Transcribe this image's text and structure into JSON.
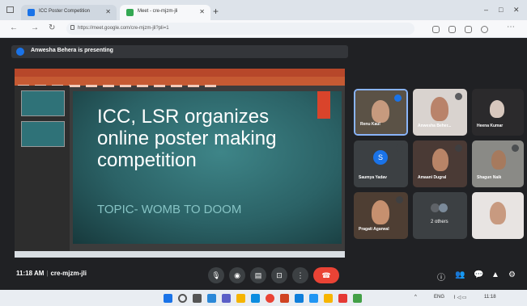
{
  "browser": {
    "tabs": [
      {
        "title": "ICC Poster Competition",
        "favicon_color": "#1a73e8"
      },
      {
        "title": "Meet - cre-mjzm-jli",
        "favicon_color": "#34a853"
      }
    ],
    "url": "https://meet.google.com/cre-mjzm-jli?pli=1",
    "window_buttons": [
      "–",
      "□",
      "✕"
    ]
  },
  "meet": {
    "presenting_text": "Anwesha Behera is presenting",
    "time": "11:18 AM",
    "meeting_code": "cre-mjzm-jli",
    "controls": [
      {
        "name": "mic",
        "glyph": "🎙"
      },
      {
        "name": "camera",
        "glyph": "◉"
      },
      {
        "name": "captions",
        "glyph": "▤"
      },
      {
        "name": "present",
        "glyph": "⊡"
      },
      {
        "name": "more",
        "glyph": "⋮"
      }
    ],
    "end_call_glyph": "☎",
    "right_icons": [
      "ⓘ",
      "👥",
      "💬",
      "▲",
      "⚙"
    ]
  },
  "slide": {
    "title": "ICC, LSR organizes online poster making competition",
    "subtitle": "TOPIC- WOMB TO DOOM"
  },
  "participants": [
    {
      "name": "Renu Kaul",
      "bg": "#5b5246"
    },
    {
      "name": "Anwesha Beher...",
      "bg": "#d9d3cf"
    },
    {
      "name": "Heena Kumar",
      "bg": "#2b2a2c"
    },
    {
      "name": "Saumya Yadav",
      "bg": "#3c4043",
      "initial": "S",
      "avatar_color": "#1a73e8"
    },
    {
      "name": "Amaani Dugral",
      "bg": "#4a3a35"
    },
    {
      "name": "Shagun Naik",
      "bg": "#8a8a86"
    },
    {
      "name": "Pragati Agarwal",
      "bg": "#4e3e33"
    },
    {
      "name": "2 others",
      "bg": "#3c4043"
    },
    {
      "name": "",
      "bg": "#e8e4e2"
    }
  ],
  "tray": {
    "language": "ENG",
    "clock": "11:18"
  },
  "colors": {
    "meet_bg": "#202124",
    "end_call": "#ea4335",
    "ppt_accent": "#b7472a"
  }
}
